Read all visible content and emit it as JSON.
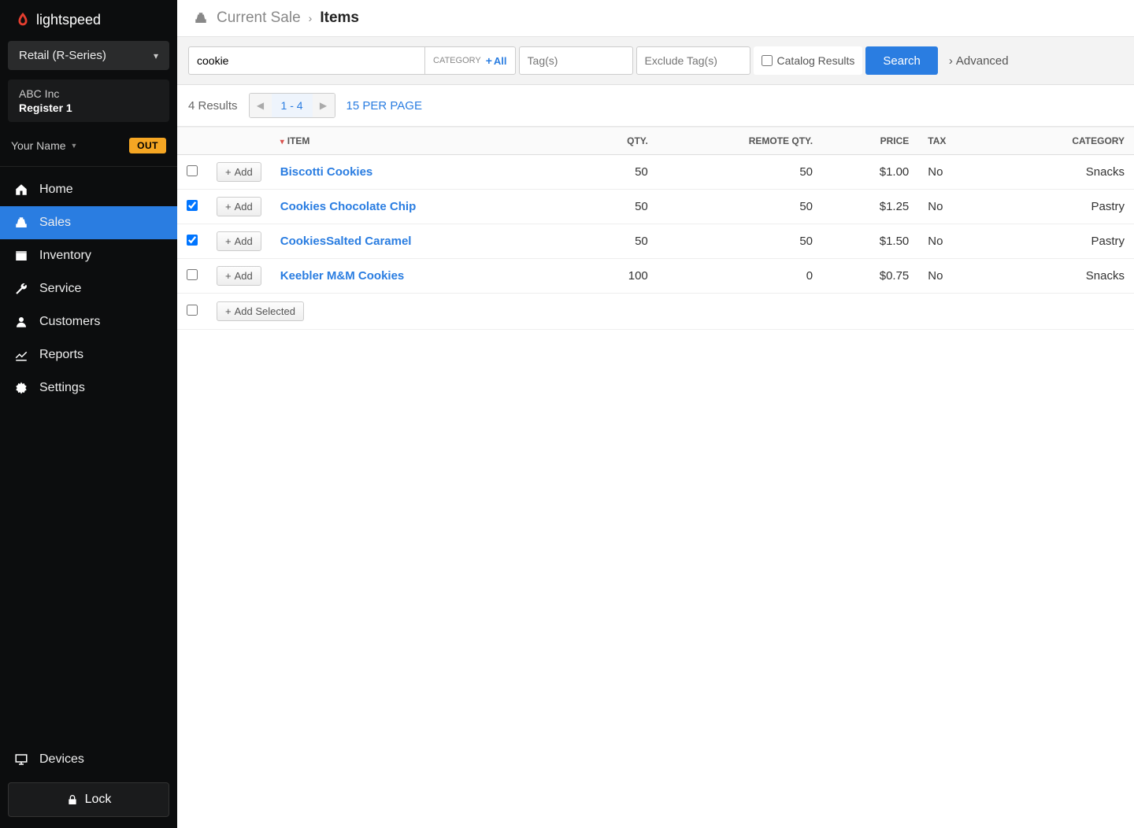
{
  "brand": "lightspeed",
  "series_selector": "Retail (R-Series)",
  "store": {
    "company": "ABC Inc",
    "register": "Register 1"
  },
  "user": {
    "name": "Your Name",
    "out_label": "OUT"
  },
  "nav": {
    "home": "Home",
    "sales": "Sales",
    "inventory": "Inventory",
    "service": "Service",
    "customers": "Customers",
    "reports": "Reports",
    "settings": "Settings",
    "devices": "Devices",
    "lock": "Lock"
  },
  "breadcrumb": {
    "parent": "Current Sale",
    "current": "Items"
  },
  "search": {
    "value": "cookie",
    "category_label": "CATEGORY",
    "category_all": "All",
    "tags_placeholder": "Tag(s)",
    "exclude_placeholder": "Exclude Tag(s)",
    "catalog_results": "Catalog Results",
    "search_btn": "Search",
    "advanced": "Advanced"
  },
  "results": {
    "count_text": "4 Results",
    "range": "1 - 4",
    "per_page": "15 PER PAGE"
  },
  "table": {
    "add_btn": "Add",
    "add_selected": "Add Selected",
    "headers": {
      "item": "ITEM",
      "qty": "QTY.",
      "remote_qty": "REMOTE QTY.",
      "price": "PRICE",
      "tax": "TAX",
      "category": "CATEGORY"
    },
    "rows": [
      {
        "checked": false,
        "name": "Biscotti Cookies",
        "qty": "50",
        "remote_qty": "50",
        "price": "$1.00",
        "tax": "No",
        "category": "Snacks"
      },
      {
        "checked": true,
        "name": "Cookies Chocolate Chip",
        "qty": "50",
        "remote_qty": "50",
        "price": "$1.25",
        "tax": "No",
        "category": "Pastry"
      },
      {
        "checked": true,
        "name": "CookiesSalted Caramel",
        "qty": "50",
        "remote_qty": "50",
        "price": "$1.50",
        "tax": "No",
        "category": "Pastry"
      },
      {
        "checked": false,
        "name": "Keebler M&M Cookies",
        "qty": "100",
        "remote_qty": "0",
        "price": "$0.75",
        "tax": "No",
        "category": "Snacks"
      }
    ]
  }
}
